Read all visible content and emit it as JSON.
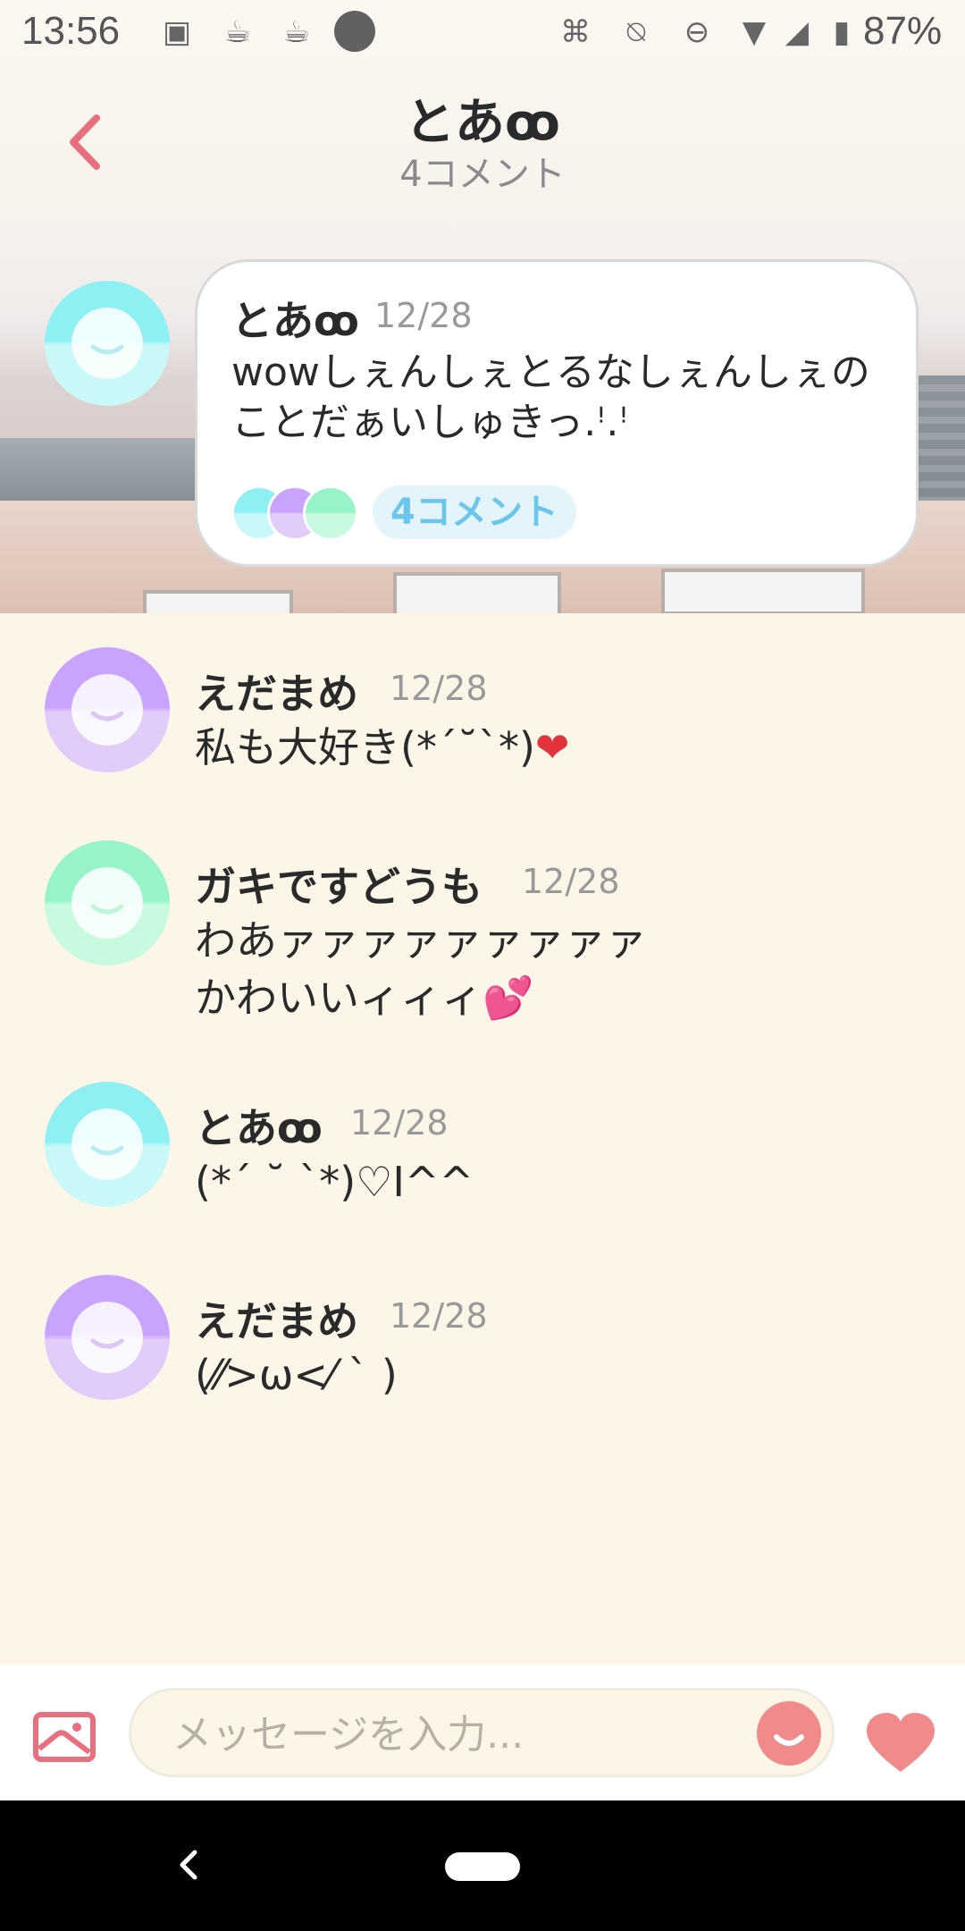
{
  "status_bar": {
    "time": "13:56",
    "battery": "87%",
    "icons": [
      "image-icon",
      "cup-icon",
      "cup-icon",
      "dot-icon",
      "nfc-icon",
      "bell-off-icon",
      "dnd-icon",
      "wifi-icon",
      "signal-icon",
      "battery-icon"
    ]
  },
  "header": {
    "title": "とあ𖹲",
    "title_plain": "とあ",
    "subtitle": "4コメント",
    "back_icon": "chevron-left-icon",
    "accent_color": "#e8707e"
  },
  "post": {
    "author": "とあ",
    "date": "12/28",
    "text": "wowしぇんしぇとるなしぇんしぇのことだぁいしゅきっ.ꜝ.ꜝ",
    "comment_chip": "4コメント",
    "avatar_color": "cyan"
  },
  "comments": [
    {
      "author": "えだまめ",
      "date": "12/28",
      "text": "私も大好き(*´˘`*)",
      "emoji": "❤",
      "avatar_color": "purple"
    },
    {
      "author": "ガキですどうも",
      "date": "12/28",
      "text": "わあァァァァァァァァァ\nかわいいィィィ",
      "emoji": "💕",
      "avatar_color": "green"
    },
    {
      "author": "とあ",
      "date": "12/28",
      "text": "(*´ ˘ `*)♡I^^",
      "emoji": "",
      "avatar_color": "cyan"
    },
    {
      "author": "えだまめ",
      "date": "12/28",
      "text": "(⁄⁄>ω<⁄ ` )",
      "emoji": "",
      "avatar_color": "purple"
    }
  ],
  "composer": {
    "placeholder": "メッセージを入力...",
    "image_icon": "image-icon",
    "emoji_icon": "smile-icon",
    "heart_icon": "heart-icon",
    "accent_color": "#f08a8c"
  },
  "nav": {
    "back_icon": "back-icon",
    "home_icon": "home-pill-icon"
  }
}
